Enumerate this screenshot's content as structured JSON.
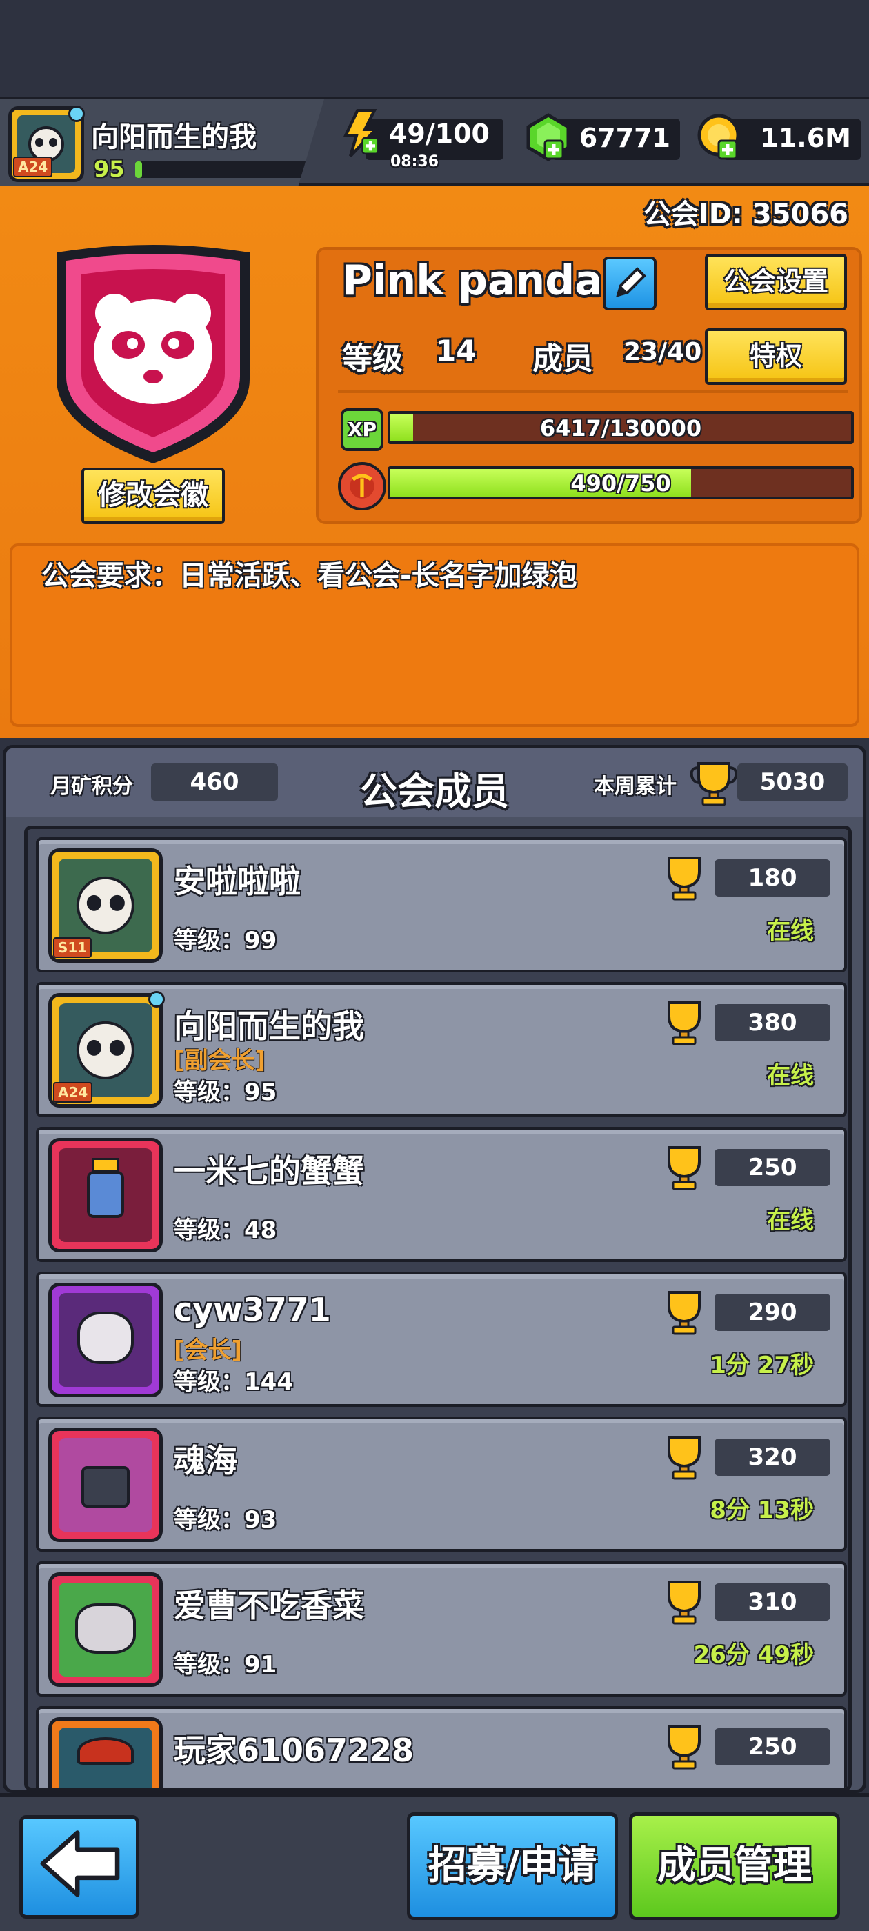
{
  "player": {
    "name": "向阳而生的我",
    "level": "95",
    "avatar_badge": "A24"
  },
  "resources": {
    "energy": "49/100",
    "energy_timer": "08:36",
    "gems": "67771",
    "coins": "11.6M"
  },
  "guild": {
    "id_label": "公会ID: 35066",
    "name": "Pink panda",
    "change_emblem_label": "修改会徽",
    "settings_label": "公会设置",
    "privilege_label": "特权",
    "level_label": "等级",
    "level_value": "14",
    "members_label": "成员",
    "members_value": "23/40",
    "xp_badge": "XP",
    "xp_text": "6417/130000",
    "xp_fraction": 0.049,
    "mine_text": "490/750",
    "mine_fraction": 0.653,
    "requirement": "公会要求：日常活跃、看公会-长名字加绿泡"
  },
  "members_panel": {
    "title": "公会成员",
    "mining_label": "月矿积分",
    "mining_value": "460",
    "week_label": "本周累计",
    "week_value": "5030",
    "rows": [
      {
        "name": "安啦啦啦",
        "role": "",
        "level": "等级：99",
        "score": "180",
        "status": "在线",
        "badge": "S11"
      },
      {
        "name": "向阳而生的我",
        "role": "[副会长]",
        "level": "等级：95",
        "score": "380",
        "status": "在线",
        "badge": "A24"
      },
      {
        "name": "一米七的蟹蟹",
        "role": "",
        "level": "等级：48",
        "score": "250",
        "status": "在线",
        "badge": ""
      },
      {
        "name": "cyw3771",
        "role": "[会长]",
        "level": "等级：144",
        "score": "290",
        "status": "1分 27秒",
        "badge": ""
      },
      {
        "name": "魂海",
        "role": "",
        "level": "等级：93",
        "score": "320",
        "status": "8分 13秒",
        "badge": ""
      },
      {
        "name": "爱曹不吃香菜",
        "role": "",
        "level": "等级：91",
        "score": "310",
        "status": "26分 49秒",
        "badge": ""
      },
      {
        "name": "玩家61067228",
        "role": "",
        "level": "",
        "score": "250",
        "status": "",
        "badge": ""
      }
    ]
  },
  "bottom": {
    "recruit_label": "招募/申请",
    "manage_label": "成员管理"
  },
  "colors": {
    "orange": "#f28a14",
    "yellow_button": "#f5c312",
    "green_bar": "#8fe01e",
    "online_green": "#c7f04a",
    "role_orange": "#f0a030"
  },
  "icons": [
    "energy-icon",
    "gem-icon",
    "coin-icon",
    "edit-icon",
    "trophy-icon",
    "back-arrow-icon",
    "pickaxe-icon"
  ]
}
